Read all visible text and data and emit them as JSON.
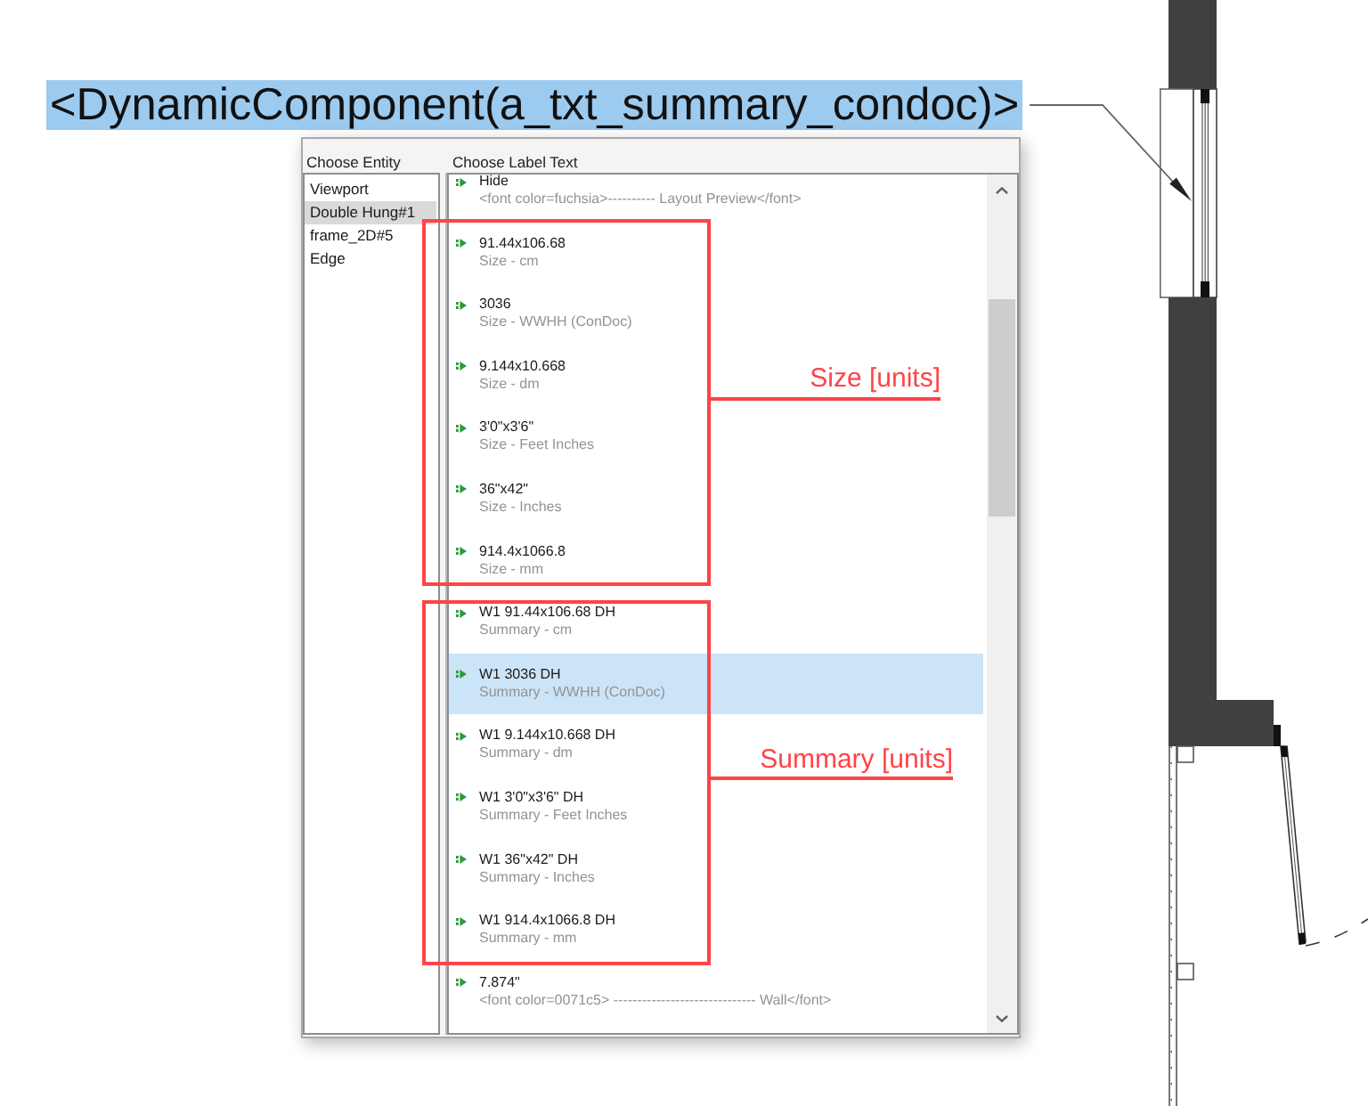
{
  "canvas_label": {
    "text": "<DynamicComponent(a_txt_summary_condoc)>",
    "selected": true
  },
  "dialog": {
    "entity_header": "Choose Entity",
    "label_header": "Choose Label Text",
    "entities": [
      {
        "label": "Viewport",
        "selected": false
      },
      {
        "label": "Double Hung#1",
        "selected": true
      },
      {
        "label": "frame_2D#5",
        "selected": false
      },
      {
        "label": "Edge",
        "selected": false
      }
    ],
    "label_options": [
      {
        "value": "Hide",
        "description": "<font color=fuchsia>---------- Layout Preview</font>",
        "selected": false
      },
      {
        "value": "91.44x106.68",
        "description": "Size - cm",
        "selected": false
      },
      {
        "value": "3036",
        "description": "Size - WWHH (ConDoc)",
        "selected": false
      },
      {
        "value": "9.144x10.668",
        "description": "Size - dm",
        "selected": false
      },
      {
        "value": "3'0\"x3'6\"",
        "description": "Size - Feet Inches",
        "selected": false
      },
      {
        "value": "36\"x42\"",
        "description": "Size - Inches",
        "selected": false
      },
      {
        "value": "914.4x1066.8",
        "description": "Size - mm",
        "selected": false
      },
      {
        "value": "W1 91.44x106.68 DH",
        "description": "Summary - cm",
        "selected": false
      },
      {
        "value": "W1 3036 DH",
        "description": "Summary - WWHH (ConDoc)",
        "selected": true
      },
      {
        "value": "W1 9.144x10.668 DH",
        "description": "Summary - dm",
        "selected": false
      },
      {
        "value": "W1 3'0\"x3'6\" DH",
        "description": "Summary - Feet Inches",
        "selected": false
      },
      {
        "value": "W1 36\"x42\" DH",
        "description": "Summary - Inches",
        "selected": false
      },
      {
        "value": "W1 914.4x1066.8 DH",
        "description": "Summary - mm",
        "selected": false
      },
      {
        "value": "7.874\"",
        "description": "<font color=0071c5> ------------------------------ Wall</font>",
        "selected": false
      }
    ]
  },
  "annotations": [
    {
      "label": "Size [units]"
    },
    {
      "label": "Summary [units]"
    }
  ]
}
